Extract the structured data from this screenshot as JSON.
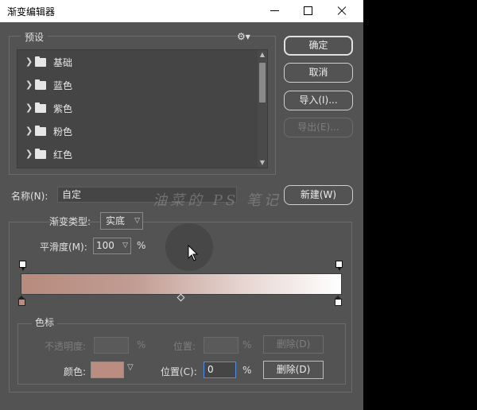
{
  "window": {
    "title": "渐变编辑器"
  },
  "presets": {
    "label": "预设",
    "items": [
      {
        "label": "基础"
      },
      {
        "label": "蓝色"
      },
      {
        "label": "紫色"
      },
      {
        "label": "粉色"
      },
      {
        "label": "红色"
      }
    ]
  },
  "buttons": {
    "ok": "确定",
    "cancel": "取消",
    "import": "导入(I)...",
    "export": "导出(E)...",
    "new": "新建(W)"
  },
  "name": {
    "label": "名称(N):",
    "value": "自定"
  },
  "watermark": "油菜的 PS 笔记",
  "gradient": {
    "type_label": "渐变类型:",
    "type_value": "实底",
    "smooth_label": "平滑度(M):",
    "smooth_value": "100",
    "smooth_unit": "%",
    "colors": {
      "start": "#b78b7e",
      "end": "#ffffff"
    }
  },
  "stops": {
    "label": "色标",
    "opacity_label": "不透明度:",
    "opacity_unit": "%",
    "opacity_location_label": "位置:",
    "opacity_location_unit": "%",
    "opacity_delete": "删除(D)",
    "color_label": "颜色:",
    "color_value": "#ba8d80",
    "location_label": "位置(C):",
    "location_value": "0",
    "location_unit": "%",
    "color_delete": "删除(D)"
  }
}
